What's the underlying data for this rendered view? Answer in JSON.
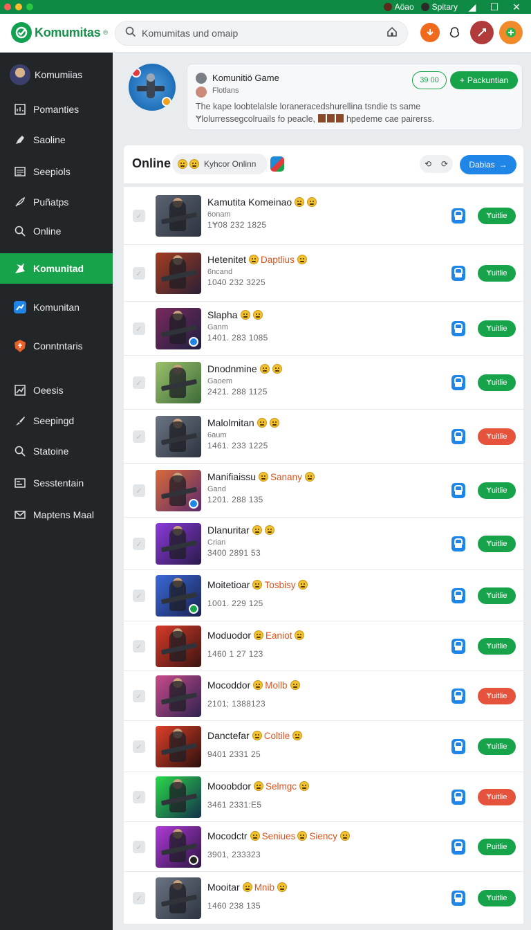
{
  "window": {
    "right_label_1": "Aöao",
    "right_label_2": "Spitary",
    "minimize_glyph": "◢",
    "maximize_glyph": "☐",
    "close_glyph": "✕"
  },
  "header": {
    "logo_text": "Komumitas",
    "logo_reg": "®",
    "search_placeholder": "Komumitas und omaip"
  },
  "sidebar": {
    "user_label": "Komumiias",
    "items": [
      {
        "label": "Pomanties",
        "icon": "chart-icon"
      },
      {
        "label": "Saoline",
        "icon": "pen-icon"
      },
      {
        "label": "Seepiols",
        "icon": "list-icon"
      },
      {
        "label": "Puñatps",
        "icon": "feather-icon"
      },
      {
        "label": "Online",
        "icon": "search-icon"
      },
      {
        "label": "Komunitad",
        "icon": "community-icon",
        "active": true
      },
      {
        "label": "Komunitan",
        "icon": "trend-icon"
      },
      {
        "label": "Conntntaris",
        "icon": "shield-icon"
      },
      {
        "label": "Oeesis",
        "icon": "analytics-icon"
      },
      {
        "label": "Seepingd",
        "icon": "brush-icon"
      },
      {
        "label": "Statoine",
        "icon": "magnifier-icon"
      },
      {
        "label": "Sesstentain",
        "icon": "stats-icon"
      },
      {
        "label": "Maptens Maal",
        "icon": "mail-icon"
      }
    ]
  },
  "profile": {
    "name": "Komunitiö Game",
    "role": "Flotlans",
    "description_line1": "The kape loobtelalsle loraneracedshurellina tsndie ts same",
    "description_line2": "Ɏlolurressegcolruails fo peacle,",
    "description_line2_tail": "hpedeme cae pairerss.",
    "count": "39 00",
    "follow_label": "Packuntian"
  },
  "online": {
    "title": "Online",
    "pill_label": "Kyhcor Onlinn",
    "action_label": "Dabias",
    "colors": {
      "accent": "#16a34a",
      "blue": "#1f86e8",
      "red": "#e5533d"
    }
  },
  "rows": [
    {
      "name": "Kamutita Komeinao",
      "tag": "",
      "sub": "6onam",
      "num": "1Ɏ08 232 1825",
      "status": "Ɏuitlie",
      "status_color": "#16a34a",
      "thumb": [
        "#5a6270",
        "#2e3440"
      ],
      "badge": ""
    },
    {
      "name": "Hetenitet",
      "tag": "Daptlius",
      "sub": "6ncand",
      "num": "1040 232 3225",
      "status": "Ɏuitlie",
      "status_color": "#16a34a",
      "thumb": [
        "#a33d1f",
        "#2a1f35"
      ],
      "badge": ""
    },
    {
      "name": "Slapha",
      "tag": "",
      "sub": "Ganm",
      "num": "1401. 283 1085",
      "status": "Ɏuitlie",
      "status_color": "#16a34a",
      "thumb": [
        "#7a2a5c",
        "#1e1f40"
      ],
      "badge": "#1f86e8"
    },
    {
      "name": "Dnodnmine",
      "tag": "",
      "sub": "Gaoem",
      "num": "2421. 288 1125",
      "status": "Ɏuitlie",
      "status_color": "#16a34a",
      "thumb": [
        "#9bc06a",
        "#3d6b3a"
      ],
      "badge": ""
    },
    {
      "name": "Malolmitan",
      "tag": "",
      "sub": "6aum",
      "num": "1461. 233 1225",
      "status": "Ɏuitlie",
      "status_color": "#e5533d",
      "thumb": [
        "#6b7484",
        "#2e3440"
      ],
      "badge": ""
    },
    {
      "name": "Manifiaissu",
      "tag": "Sanany",
      "sub": "Gand",
      "num": "1201. 288 135",
      "status": "Ɏuitlie",
      "status_color": "#16a34a",
      "thumb": [
        "#d96a3a",
        "#5a2a6b"
      ],
      "badge": "#1f86e8"
    },
    {
      "name": "Dlanuritar",
      "tag": "",
      "sub": "Crian",
      "num": "3400 2891 53",
      "status": "Ɏuitlie",
      "status_color": "#16a34a",
      "thumb": [
        "#8a3ad9",
        "#2a1a4a"
      ],
      "badge": ""
    },
    {
      "name": "Moitetioar",
      "tag": "Tosbisy",
      "sub": "",
      "num": "1001. 229 125",
      "status": "Ɏuitlie",
      "status_color": "#16a34a",
      "thumb": [
        "#3a6ad9",
        "#1a2050"
      ],
      "badge": "#16a34a"
    },
    {
      "name": "Moduodor",
      "tag": "Eaniot",
      "sub": "",
      "num": "1460 1 27 123",
      "status": "Ɏuitlie",
      "status_color": "#16a34a",
      "thumb": [
        "#d93a2a",
        "#3a1410"
      ],
      "badge": ""
    },
    {
      "name": "Mocoddor",
      "tag": "Mollb",
      "sub": "",
      "num": "2101; 1388123",
      "status": "Ɏuitlie",
      "status_color": "#e5533d",
      "thumb": [
        "#c84a8a",
        "#2e2250"
      ],
      "badge": ""
    },
    {
      "name": "Danctefar",
      "tag": "Coltile",
      "sub": "",
      "num": "9401 2331 25",
      "status": "Ɏuitlie",
      "status_color": "#16a34a",
      "thumb": [
        "#e0402a",
        "#2a0f0c"
      ],
      "badge": ""
    },
    {
      "name": "Mooobdor",
      "tag": "Selmgc",
      "sub": "",
      "num": "3461 2331:E5",
      "status": "Ɏuitlie",
      "status_color": "#e5533d",
      "thumb": [
        "#2ad94a",
        "#14304a"
      ],
      "badge": ""
    },
    {
      "name": "Mocodctr",
      "tag": "Seniues",
      "tag2": "Siency",
      "sub": "",
      "num": "3901, 233323",
      "status": "Puitlie",
      "status_color": "#16a34a",
      "thumb": [
        "#b03ad9",
        "#2a1440"
      ],
      "badge": "#222"
    },
    {
      "name": "Mooitar",
      "tag": "Mnib",
      "sub": "",
      "num": "1460 238 135",
      "status": "Ɏuitlie",
      "status_color": "#16a34a",
      "thumb": [
        "#6b7484",
        "#2e3440"
      ],
      "badge": ""
    }
  ]
}
